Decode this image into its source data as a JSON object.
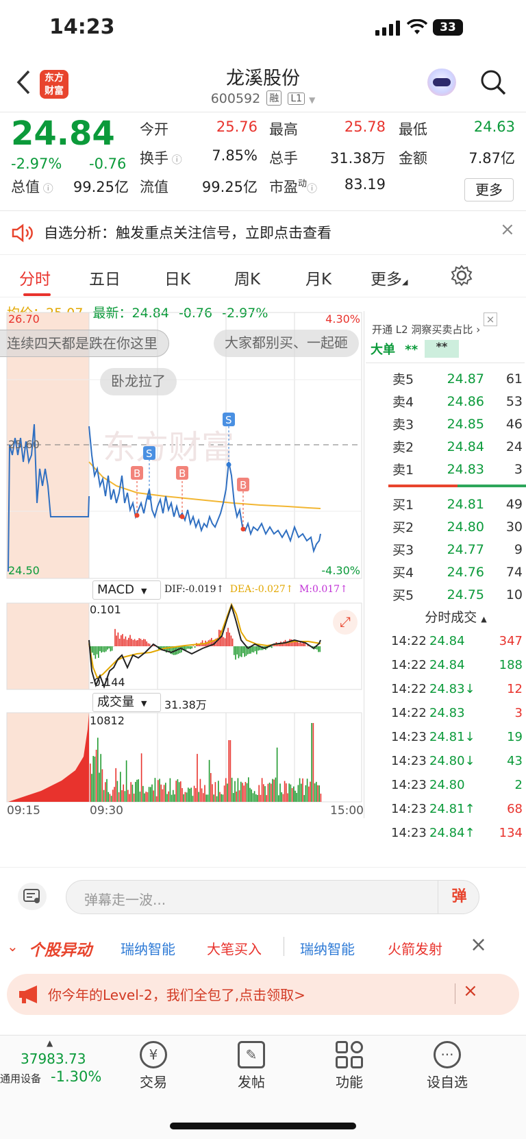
{
  "status_bar": {
    "time": "14:23",
    "battery": "33"
  },
  "header": {
    "title": "龙溪股份",
    "code": "600592",
    "tag1": "融",
    "tag2": "L1",
    "logo_text": "东方财富"
  },
  "quote": {
    "price": "24.84",
    "change_pct": "-2.97%",
    "change": "-0.76",
    "open_label": "今开",
    "open": "25.76",
    "high_label": "最高",
    "high": "25.78",
    "low_label": "最低",
    "low": "24.63",
    "turnover_label": "换手",
    "turnover": "7.85%",
    "volume_label": "总手",
    "volume": "31.38万",
    "amount_label": "金额",
    "amount": "7.87亿",
    "mktcap_label": "总值",
    "mktcap": "99.25亿",
    "float_label": "流值",
    "float": "99.25亿",
    "pe_label": "市盈",
    "pe_sup": "动",
    "pe": "83.19",
    "more": "更多"
  },
  "notice": {
    "text": "自选分析：触发重点关注信号，立即点击查看"
  },
  "tabs": [
    "分时",
    "五日",
    "日K",
    "周K",
    "月K",
    "更多"
  ],
  "summary": {
    "avg_label": "均价：",
    "avg": "25.07",
    "latest_label": "最新：",
    "latest": "24.84",
    "chg": "-0.76",
    "pct": "-2.97%"
  },
  "chart": {
    "y_top": "26.70",
    "y_mid": "25.60",
    "y_bottom": "24.50",
    "pct_top": "4.30%",
    "pct_bottom": "-4.30%",
    "watermark": "东方财富",
    "danmu": [
      "连续四天都是跌在你这里",
      "大家都别买、一起砸",
      "卧龙拉了"
    ],
    "x_labels": [
      "09:15",
      "09:30",
      "15:00"
    ]
  },
  "macd": {
    "label": "MACD",
    "dif": "DIF:-0.019↑",
    "dea": "DEA:-0.027↑",
    "m": "M:0.017↑",
    "top": "0.101",
    "bottom": "-0.144"
  },
  "vol": {
    "label": "成交量",
    "total": "31.38万",
    "max": "10812"
  },
  "l2": {
    "text": "开通 L2 洞察买卖占比",
    "big_label": "大单",
    "big_a": "**",
    "big_b": "**"
  },
  "orderbook": {
    "asks": [
      {
        "label": "卖5",
        "price": "24.87",
        "vol": "61"
      },
      {
        "label": "卖4",
        "price": "24.86",
        "vol": "53"
      },
      {
        "label": "卖3",
        "price": "24.85",
        "vol": "46"
      },
      {
        "label": "卖2",
        "price": "24.84",
        "vol": "24"
      },
      {
        "label": "卖1",
        "price": "24.83",
        "vol": "3"
      }
    ],
    "bids": [
      {
        "label": "买1",
        "price": "24.81",
        "vol": "49"
      },
      {
        "label": "买2",
        "price": "24.80",
        "vol": "30"
      },
      {
        "label": "买3",
        "price": "24.77",
        "vol": "9"
      },
      {
        "label": "买4",
        "price": "24.76",
        "vol": "74"
      },
      {
        "label": "买5",
        "price": "24.75",
        "vol": "10"
      }
    ]
  },
  "ticks": {
    "title": "分时成交",
    "rows": [
      {
        "t": "14:22",
        "p": "24.84",
        "v": "347",
        "pc": "green",
        "vc": "red"
      },
      {
        "t": "14:22",
        "p": "24.84",
        "v": "188",
        "pc": "green",
        "vc": "green"
      },
      {
        "t": "14:22",
        "p": "24.83↓",
        "v": "12",
        "pc": "green",
        "vc": "red"
      },
      {
        "t": "14:22",
        "p": "24.83",
        "v": "3",
        "pc": "green",
        "vc": "red"
      },
      {
        "t": "14:23",
        "p": "24.81↓",
        "v": "19",
        "pc": "green",
        "vc": "green"
      },
      {
        "t": "14:23",
        "p": "24.80↓",
        "v": "43",
        "pc": "green",
        "vc": "green"
      },
      {
        "t": "14:23",
        "p": "24.80",
        "v": "2",
        "pc": "green",
        "vc": "green"
      },
      {
        "t": "14:23",
        "p": "24.81↑",
        "v": "68",
        "pc": "green",
        "vc": "red"
      },
      {
        "t": "14:23",
        "p": "24.84↑",
        "v": "134",
        "pc": "green",
        "vc": "red"
      }
    ]
  },
  "danmu_input": {
    "placeholder": "弹幕走一波...",
    "send": "弹"
  },
  "alert_bar": {
    "title": "个股异动",
    "items": [
      "瑞纳智能",
      "大笔买入",
      "瑞纳智能",
      "火箭发射"
    ]
  },
  "promo": {
    "text": "你今年的Level-2，我们全包了,点击领取>"
  },
  "nav": {
    "index_value": "37983.73",
    "index_name": "通用设备",
    "index_pct": "-1.30%",
    "items": [
      "交易",
      "发帖",
      "功能",
      "设自选"
    ]
  }
}
